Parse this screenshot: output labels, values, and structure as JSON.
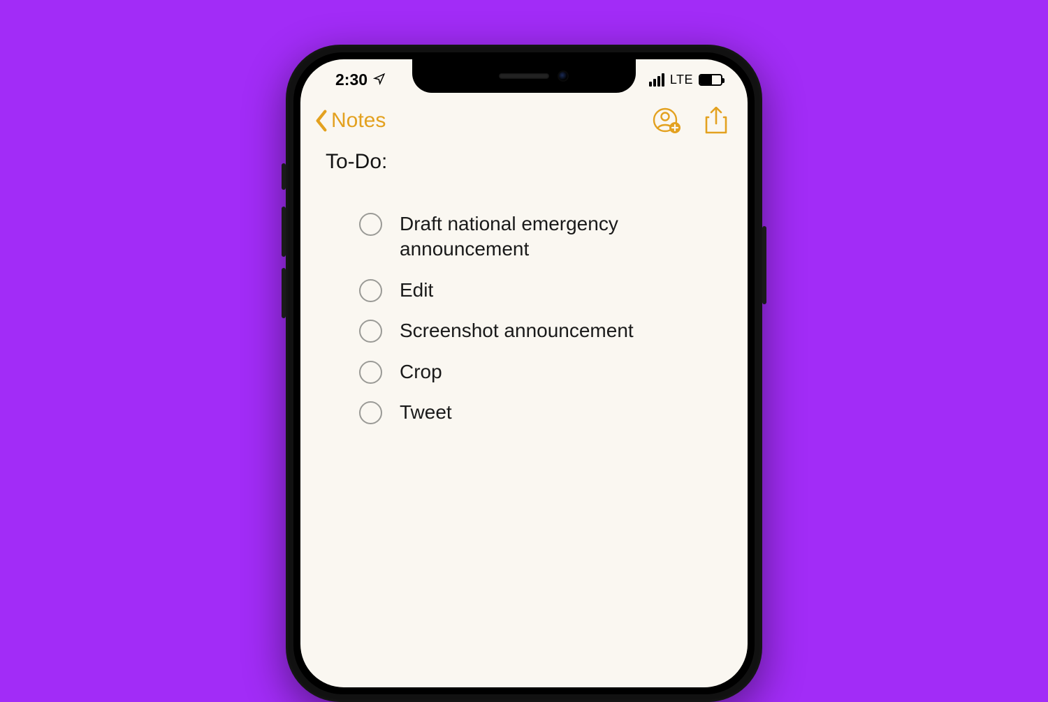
{
  "status": {
    "time": "2:30",
    "network": "LTE"
  },
  "nav": {
    "back_label": "Notes"
  },
  "note": {
    "title": "To-Do:",
    "items": [
      "Draft national emergency announcement",
      "Edit",
      "Screenshot announcement",
      "Crop",
      "Tweet"
    ]
  },
  "colors": {
    "background": "#a22cf7",
    "accent": "#e3a11f",
    "paper": "#faf7f1"
  }
}
